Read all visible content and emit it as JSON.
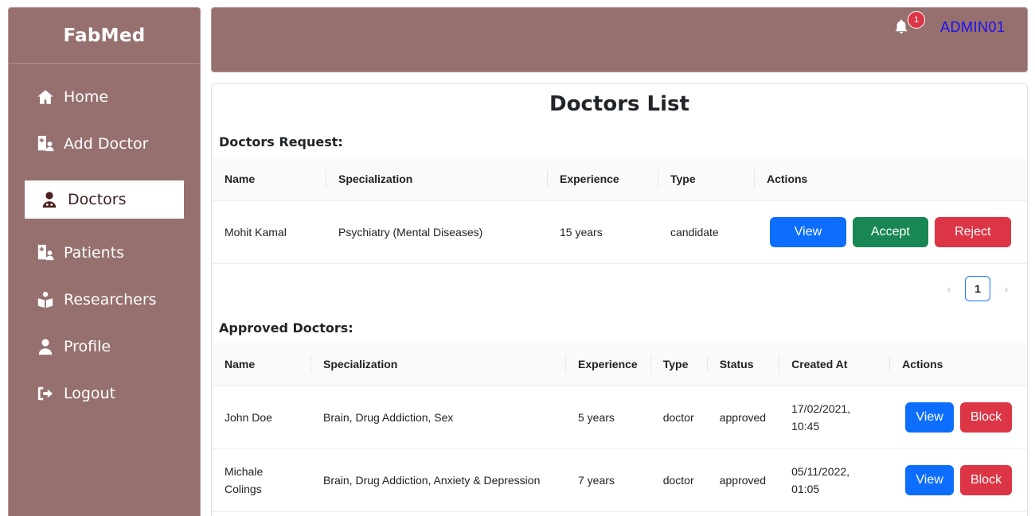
{
  "brand": "FabMed",
  "sidebar": {
    "items": [
      {
        "label": "Home",
        "icon": "home-icon"
      },
      {
        "label": "Add Doctor",
        "icon": "hospital-user-icon"
      },
      {
        "label": "Doctors",
        "icon": "user-doctor-icon",
        "active": true
      },
      {
        "label": "Patients",
        "icon": "hospital-user-icon"
      },
      {
        "label": "Researchers",
        "icon": "book-reader-icon"
      },
      {
        "label": "Profile",
        "icon": "user-icon"
      },
      {
        "label": "Logout",
        "icon": "sign-out-icon"
      }
    ]
  },
  "topbar": {
    "notification_count": "1",
    "user": "ADMIN01"
  },
  "main": {
    "title": "Doctors List",
    "requests": {
      "label": "Doctors Request:",
      "headers": [
        "Name",
        "Specialization",
        "Experience",
        "Type",
        "Actions"
      ],
      "rows": [
        {
          "name": "Mohit Kamal",
          "specialization": "Psychiatry (Mental Diseases)",
          "experience": "15 years",
          "type": "candidate"
        }
      ],
      "actions": {
        "view": "View",
        "accept": "Accept",
        "reject": "Reject"
      },
      "pagination": {
        "prev": "‹",
        "page": "1",
        "next": "›"
      }
    },
    "approved": {
      "label": "Approved Doctors:",
      "headers": [
        "Name",
        "Specialization",
        "Experience",
        "Type",
        "Status",
        "Created At",
        "Actions"
      ],
      "rows": [
        {
          "name": "John Doe",
          "specialization": "Brain, Drug Addiction, Sex",
          "experience": "5 years",
          "type": "doctor",
          "status": "approved",
          "created_date": "17/02/2021,",
          "created_time": "10:45"
        },
        {
          "name_line1": "Michale",
          "name_line2": "Colings",
          "specialization": "Brain, Drug Addiction, Anxiety & Depression",
          "experience": "7 years",
          "type": "doctor",
          "status": "approved",
          "created_date": "05/11/2022,",
          "created_time": "01:05"
        }
      ],
      "actions": {
        "view": "View",
        "block": "Block"
      }
    }
  },
  "colors": {
    "sidebar": "#95706f",
    "primary": "#0d6efd",
    "success": "#198754",
    "danger": "#dc3545",
    "admin_text": "#1a0ff5"
  }
}
